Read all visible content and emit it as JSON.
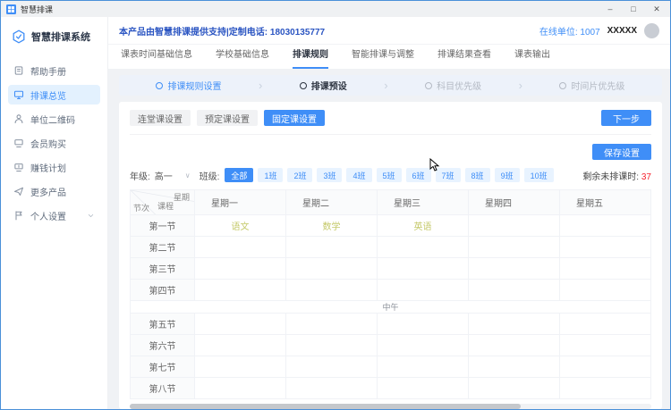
{
  "window": {
    "title": "智慧排课",
    "minimize": "–",
    "maximize": "□",
    "close": "✕"
  },
  "sidebar": {
    "brand": "智慧排课系统",
    "items": [
      {
        "id": "help-manual",
        "label": "帮助手册",
        "icon": "help-book-icon",
        "active": false,
        "chevron": false
      },
      {
        "id": "overview",
        "label": "排课总览",
        "icon": "monitor-icon",
        "active": true,
        "chevron": false
      },
      {
        "id": "unit-qrcode",
        "label": "单位二维码",
        "icon": "person-icon",
        "active": false,
        "chevron": false
      },
      {
        "id": "member-buy",
        "label": "会员购买",
        "icon": "purchase-icon",
        "active": false,
        "chevron": false
      },
      {
        "id": "earn-plan",
        "label": "赚钱计划",
        "icon": "money-plan-icon",
        "active": false,
        "chevron": false
      },
      {
        "id": "more-products",
        "label": "更多产品",
        "icon": "paper-plane-icon",
        "active": false,
        "chevron": false
      },
      {
        "id": "personal",
        "label": "个人设置",
        "icon": "flag-icon",
        "active": false,
        "chevron": true
      }
    ]
  },
  "header": {
    "support_text": "本产品由智慧排课提供支持|定制电话: 18030135777",
    "online_label": "在线单位:",
    "online_count": "1007",
    "username": "XXXXX"
  },
  "tabs": [
    {
      "label": "课表时间基础信息",
      "active": false
    },
    {
      "label": "学校基础信息",
      "active": false
    },
    {
      "label": "排课规则",
      "active": true
    },
    {
      "label": "智能排课与调整",
      "active": false
    },
    {
      "label": "排课结果查看",
      "active": false
    },
    {
      "label": "课表输出",
      "active": false
    }
  ],
  "steps": [
    {
      "label": "排课规则设置",
      "state": "done"
    },
    {
      "label": "排课预设",
      "state": "current"
    },
    {
      "label": "科目优先级",
      "state": "todo"
    },
    {
      "label": "时间片优先级",
      "state": "todo"
    }
  ],
  "preset": {
    "buttons": [
      {
        "label": "连堂课设置",
        "active": false
      },
      {
        "label": "预定课设置",
        "active": false
      },
      {
        "label": "固定课设置",
        "active": true
      }
    ],
    "next_button": "下一步",
    "save_button": "保存设置"
  },
  "filter": {
    "grade_label": "年级:",
    "grade_value": "高一",
    "class_label": "班级:",
    "classes": [
      "全部",
      "1班",
      "2班",
      "3班",
      "4班",
      "5班",
      "6班",
      "7班",
      "8班",
      "9班",
      "10班"
    ],
    "active_class": "全部",
    "remaining_label": "剩余未排课时:",
    "remaining_value": "37"
  },
  "timetable": {
    "corner": {
      "top": "星期",
      "middle": "课程",
      "bottom": "节次"
    },
    "days": [
      "星期一",
      "星期二",
      "星期三",
      "星期四",
      "星期五"
    ],
    "periods": [
      "第一节",
      "第二节",
      "第三节",
      "第四节",
      "第五节",
      "第六节",
      "第七节",
      "第八节"
    ],
    "noon_label": "中午",
    "noon_after_period_index": 3,
    "entries": [
      {
        "period": 0,
        "day": 0,
        "subject": "语文"
      },
      {
        "period": 0,
        "day": 1,
        "subject": "数学"
      },
      {
        "period": 0,
        "day": 2,
        "subject": "英语"
      }
    ]
  },
  "colors": {
    "primary": "#3f8ef7",
    "danger": "#f5222d",
    "subject": "#c5c96a",
    "header_link": "#2b55c2"
  }
}
